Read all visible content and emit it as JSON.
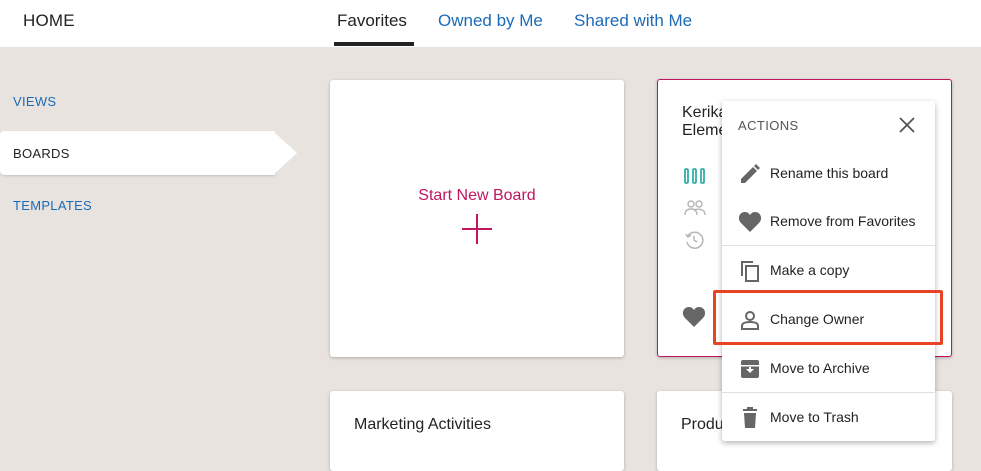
{
  "header": {
    "home_label": "HOME",
    "tabs": [
      {
        "label": "Favorites",
        "active": true
      },
      {
        "label": "Owned by Me",
        "active": false
      },
      {
        "label": "Shared with Me",
        "active": false
      }
    ]
  },
  "sidebar": {
    "items": [
      {
        "label": "VIEWS",
        "active": false
      },
      {
        "label": "BOARDS",
        "active": true
      },
      {
        "label": "TEMPLATES",
        "active": false
      }
    ]
  },
  "cards": {
    "new_board": {
      "label": "Start New Board"
    },
    "selected": {
      "title": "Kerika\nEleme"
    },
    "bottom": [
      {
        "title": "Marketing Activities"
      },
      {
        "title": "Produ"
      }
    ]
  },
  "actions_menu": {
    "header": "ACTIONS",
    "items": [
      {
        "label": "Rename this board",
        "icon": "pencil-icon"
      },
      {
        "label": "Remove from Favorites",
        "icon": "heart-icon"
      },
      {
        "label": "Make a copy",
        "icon": "copy-icon"
      },
      {
        "label": "Change Owner",
        "icon": "person-icon"
      },
      {
        "label": "Move to Archive",
        "icon": "archive-icon"
      },
      {
        "label": "Move to Trash",
        "icon": "trash-icon"
      }
    ]
  },
  "colors": {
    "accent": "#c0165f",
    "link": "#1b6bb8",
    "highlight": "#e84424",
    "background": "#e8e3de"
  }
}
